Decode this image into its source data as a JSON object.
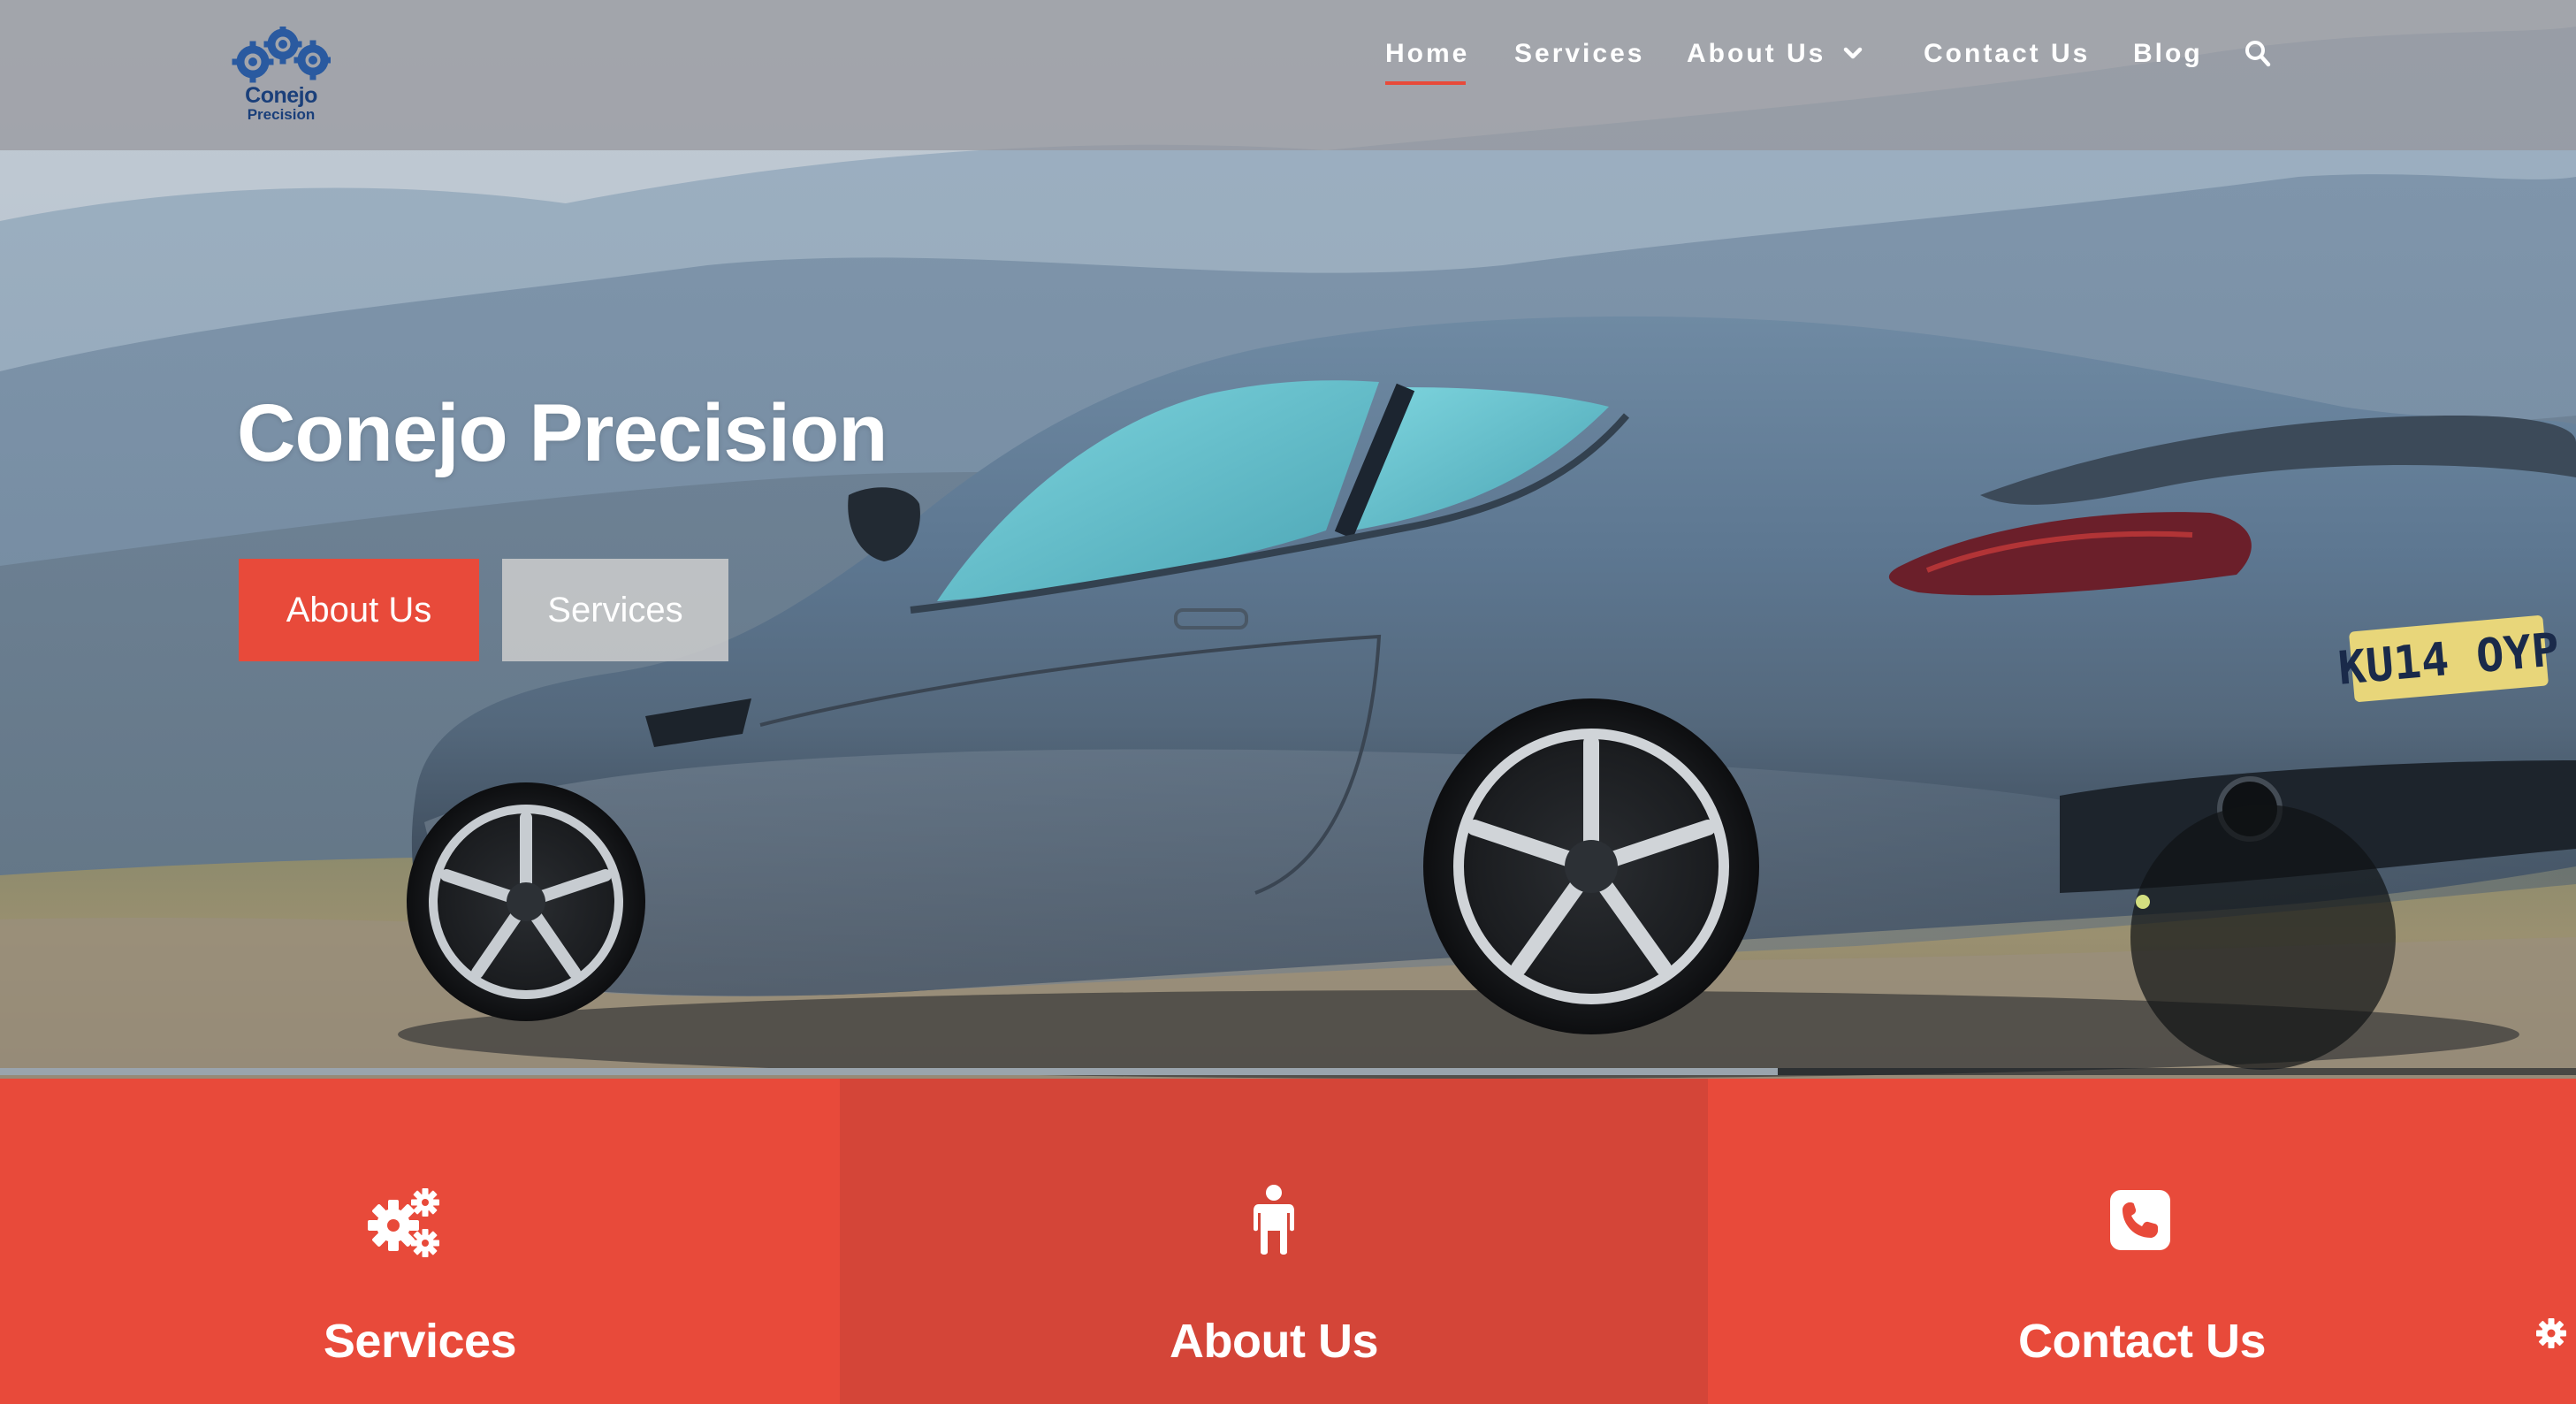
{
  "header": {
    "logo": {
      "line1": "Conejo",
      "line2": "Precision",
      "icon": "gears-logo-icon",
      "color": "#1a3f7a"
    },
    "nav": {
      "home": "Home",
      "services": "Services",
      "about": "About Us",
      "contact": "Contact Us",
      "blog": "Blog",
      "search_icon": "search-icon",
      "dropdown_icon": "chevron-down-icon",
      "active_item": "Home"
    }
  },
  "hero": {
    "title": "Conejo Precision",
    "buttons": {
      "about": "About Us",
      "services": "Services"
    },
    "slider_progress": 0.69,
    "license_plate": "KU14 OYP"
  },
  "features": {
    "services": {
      "label": "Services",
      "icon": "gears-icon"
    },
    "about": {
      "label": "About Us",
      "icon": "person-icon"
    },
    "contact": {
      "label": "Contact Us",
      "icon": "phone-icon"
    }
  },
  "colors": {
    "accent": "#e84a3a",
    "accent_dark": "#d44538",
    "header_overlay": "#96969b",
    "secondary_button": "#cdcdcd",
    "text": "#ffffff"
  },
  "settings_icon": "gear-icon"
}
